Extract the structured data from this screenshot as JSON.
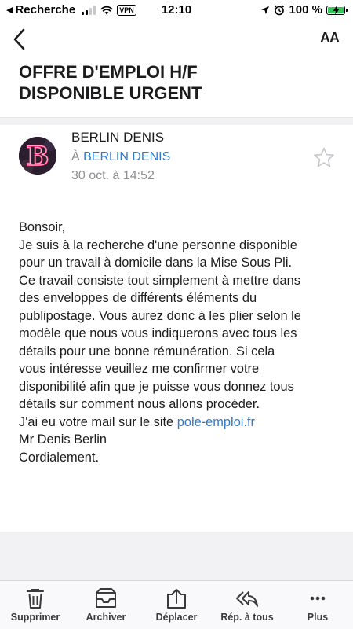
{
  "status_bar": {
    "back_app": "Recherche",
    "vpn": "VPN",
    "time": "12:10",
    "battery": "100 %"
  },
  "nav": {
    "text_size_label": "AA"
  },
  "email": {
    "subject_lines": [
      "OFFRE D'EMPLOI H/F",
      "DISPONIBLE URGENT"
    ],
    "sender": "BERLIN DENIS",
    "to_prefix": "À",
    "to_name": "BERLIN DENIS",
    "date": "30 oct. à 14:52",
    "avatar_letter": "B",
    "body_lines": [
      "Bonsoir,",
      "Je suis à la recherche d'une personne disponible",
      "pour un travail à domicile dans la Mise Sous Pli.",
      "Ce travail consiste tout simplement à mettre dans",
      "des enveloppes de différents éléments du",
      "publipostage. Vous aurez donc à les plier selon le",
      "modèle que nous vous indiquerons avec tous les",
      "détails pour une bonne rémunération. Si cela",
      "vous intéresse veuillez me confirmer votre",
      "disponibilité afin que je puisse vous donnez tous",
      "détails sur comment nous allons procéder."
    ],
    "site_prefix": "J'ai eu votre mail sur le site ",
    "site_link": "pole-emploi.fr",
    "signature": "Mr Denis Berlin",
    "closing": "Cordialement."
  },
  "toolbar": {
    "delete": "Supprimer",
    "archive": "Archiver",
    "move": "Déplacer",
    "reply_all": "Rép. à tous",
    "more": "Plus"
  }
}
